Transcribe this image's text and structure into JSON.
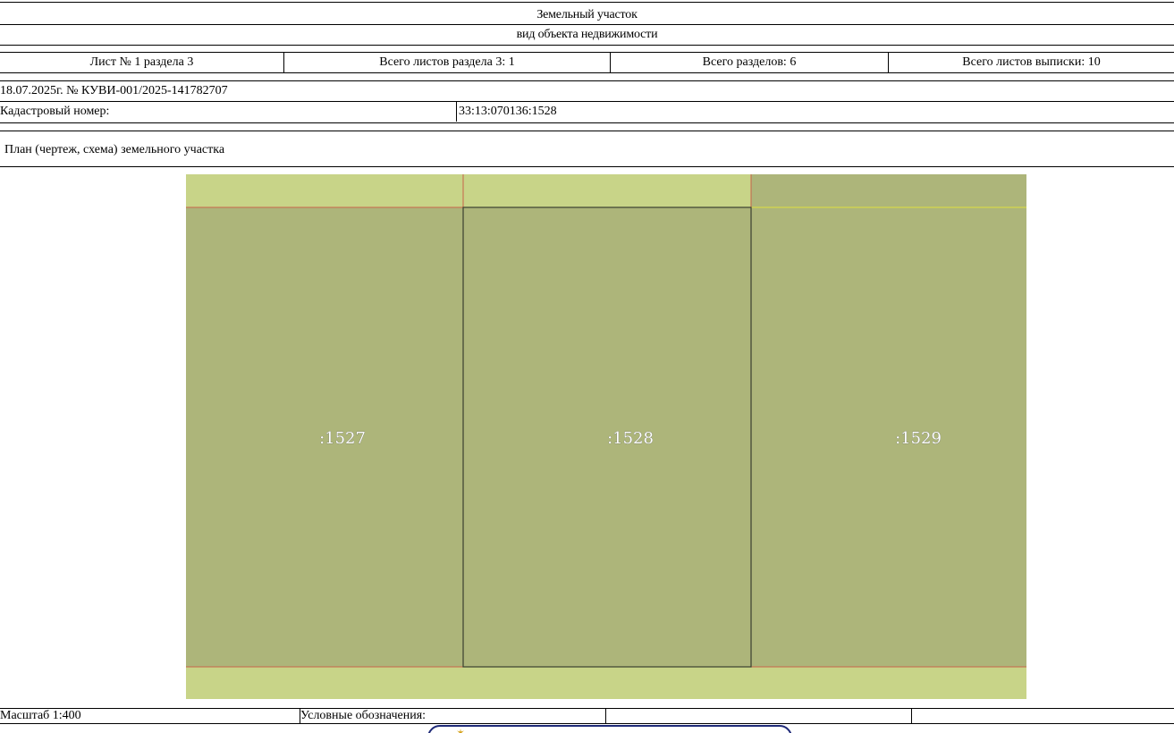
{
  "header": {
    "title": "Земельный участок",
    "subtitle": "вид объекта недвижимости"
  },
  "sheets": {
    "sheet_no": "Лист № 1 раздела 3",
    "total_section_sheets": "Всего листов раздела 3: 1",
    "total_sections": "Всего разделов: 6",
    "total_extract_sheets": "Всего листов выписки: 10"
  },
  "extract": {
    "date_number": "18.07.2025г. № КУВИ-001/2025-141782707"
  },
  "cadastral": {
    "label": "Кадастровый номер:",
    "value": "33:13:070136:1528"
  },
  "plan": {
    "title": "План (чертеж, схема) земельного участка"
  },
  "map": {
    "parcels": [
      {
        "label": ":1527"
      },
      {
        "label": ":1528"
      },
      {
        "label": ":1529"
      }
    ],
    "colors": {
      "parcel_fill": "#adb57a",
      "strip_fill": "#c8d488",
      "boundary_line": "#c8654a",
      "selected_outline": "#3a4030",
      "grid_line": "#e0e040"
    }
  },
  "footer": {
    "scale": "Масштаб 1:400",
    "legend_label": "Условные обозначения:",
    "cell3": "",
    "cell4": ""
  },
  "stamp": {
    "border_color": "#1f2a78",
    "emblem_icon": "emblem-icon"
  }
}
